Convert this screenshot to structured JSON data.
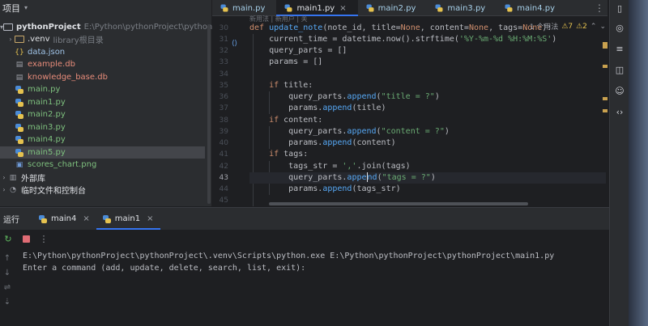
{
  "project": {
    "header_label": "项目",
    "tree": [
      {
        "label": "pythonProject",
        "hint": "E:\\Python\\pythonProject\\pythonProject",
        "type": "root"
      },
      {
        "label": ".venv",
        "hint": "library根目录",
        "type": "venv"
      },
      {
        "label": "data.json",
        "type": "file-json"
      },
      {
        "label": "example.db",
        "type": "file-db"
      },
      {
        "label": "knowledge_base.db",
        "type": "file-db"
      },
      {
        "label": "main.py",
        "type": "py"
      },
      {
        "label": "main1.py",
        "type": "py"
      },
      {
        "label": "main2.py",
        "type": "py"
      },
      {
        "label": "main3.py",
        "type": "py"
      },
      {
        "label": "main4.py",
        "type": "py"
      },
      {
        "label": "main5.py",
        "type": "py"
      },
      {
        "label": "scores_chart.png",
        "type": "file-png"
      },
      {
        "label": "外部库",
        "type": "lib"
      },
      {
        "label": "临时文件和控制台",
        "type": "scratch"
      }
    ]
  },
  "editor": {
    "tabs": [
      {
        "label": "main.py"
      },
      {
        "label": "main1.py",
        "active": true
      },
      {
        "label": "main2.py"
      },
      {
        "label": "main3.py"
      },
      {
        "label": "main4.py"
      }
    ],
    "tab_close": "×",
    "tab_more": "⋮",
    "usages_hint": "新用法 | 新用户 | 关",
    "usage_count": "1 个用法",
    "warnings": "⚠7",
    "weak_warnings": "⚠2",
    "line_numbers": [
      "30",
      "31",
      "32",
      "33",
      "34",
      "35",
      "36",
      "37",
      "38",
      "39",
      "40",
      "41",
      "42",
      "43",
      "44",
      "45"
    ],
    "current_line": "43"
  },
  "run": {
    "title": "运行",
    "tabs": [
      {
        "label": "main4"
      },
      {
        "label": "main1",
        "active": true
      }
    ],
    "tab_close": "×",
    "console_lines": [
      "E:\\Python\\pythonProject\\pythonProject\\.venv\\Scripts\\python.exe E:\\Python\\pythonProject\\pythonProject\\main1.py",
      "Enter a command (add, update, delete, search, list, exit):"
    ]
  },
  "colors": {
    "accent": "#3574f0",
    "background": "#1e1f22",
    "panel": "#2b2d30",
    "keyword": "#cf8e6d",
    "string": "#6aab73",
    "function": "#56a8f5"
  }
}
